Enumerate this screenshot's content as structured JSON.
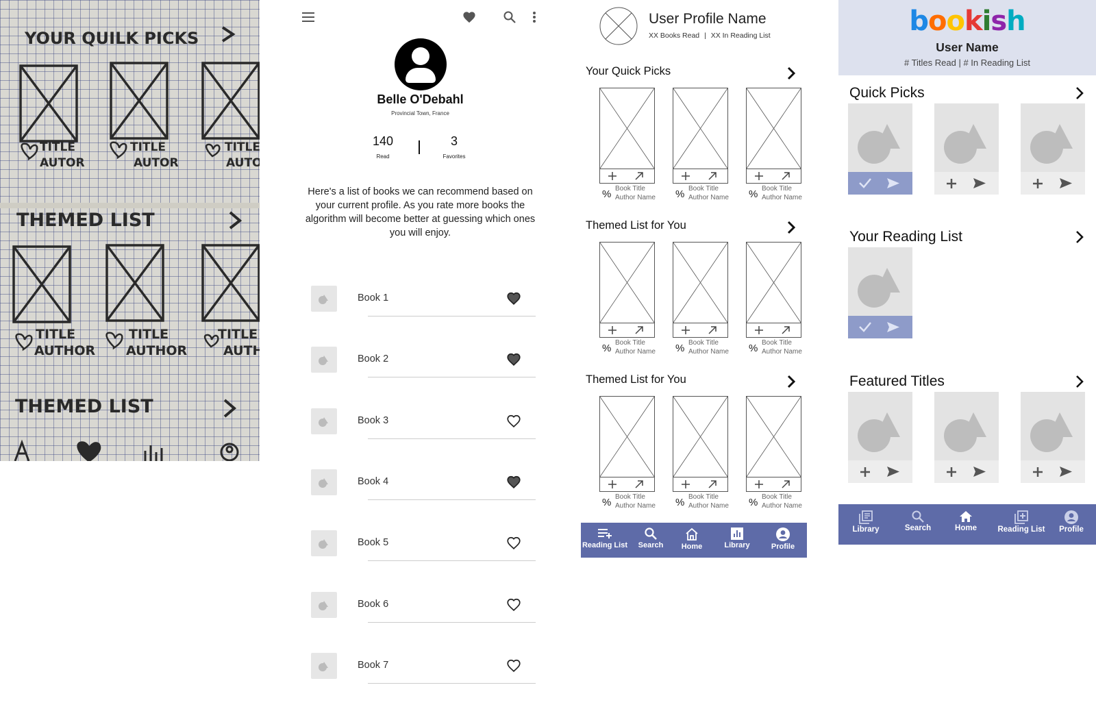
{
  "sketch": {
    "sections": [
      {
        "title": "YOUR QUILK PICKS",
        "caption_top": "TITLE",
        "caption_bottom": "AUTOR"
      },
      {
        "title": "THEMED LIST",
        "caption_top": "TITLE",
        "caption_bottom": "AUTHOR"
      },
      {
        "title": "THEMED LIST"
      }
    ]
  },
  "profile": {
    "name": "Belle O'Debahl",
    "location": "Provincial Town, France",
    "read_count": "140",
    "read_label": "Read",
    "fav_count": "3",
    "fav_label": "Favorites",
    "description": "Here's a list of books we can recommend based on your current profile. As you rate more books the algorithm will become better at guessing which ones you will enjoy.",
    "books": [
      {
        "label": "Book 1",
        "favorited": true
      },
      {
        "label": "Book 2",
        "favorited": true
      },
      {
        "label": "Book 3",
        "favorited": false
      },
      {
        "label": "Book 4",
        "favorited": true
      },
      {
        "label": "Book 5",
        "favorited": false
      },
      {
        "label": "Book 6",
        "favorited": false
      },
      {
        "label": "Book 7",
        "favorited": false
      }
    ]
  },
  "wireframe": {
    "user_name": "User Profile Name",
    "books_read": "XX Books Read",
    "separator": "|",
    "in_list": "XX In Reading List",
    "sections": [
      "Your Quick Picks",
      "Themed List for You",
      "Themed List for You"
    ],
    "card_percent": "%",
    "card_title": "Book Title",
    "card_author": "Author Name",
    "nav": [
      "Reading List",
      "Search",
      "Home",
      "Library",
      "Profile"
    ]
  },
  "bookish": {
    "logo_letters": [
      "b",
      "o",
      "o",
      "k",
      "i",
      "s",
      "h"
    ],
    "logo_colors": [
      "#1e88e5",
      "#ff6d00",
      "#ffc400",
      "#e53935",
      "#2e7d32",
      "#8e24aa",
      "#00acc1"
    ],
    "user_name": "User Name",
    "stats": "# Titles Read | # In Reading List",
    "sections": [
      "Quick Picks",
      "Your Reading List",
      "Featured Titles"
    ],
    "nav": [
      "Library",
      "Search",
      "Home",
      "Reading List",
      "Profile"
    ],
    "nav_color": "#5e6ba8"
  }
}
